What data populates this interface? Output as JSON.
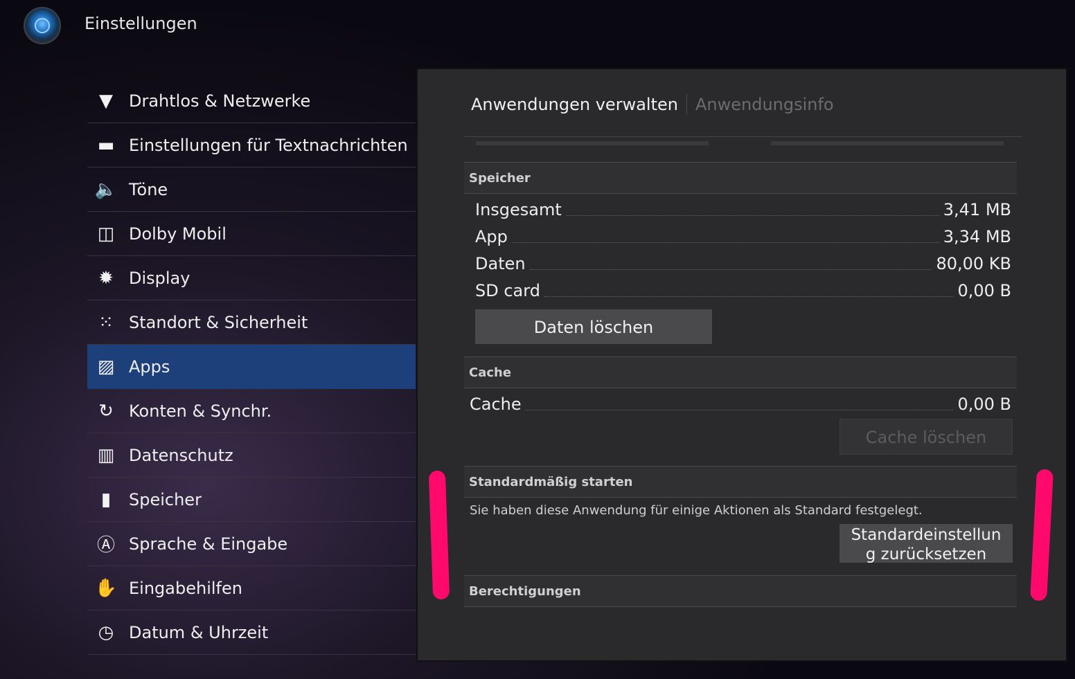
{
  "header": {
    "title": "Einstellungen",
    "icon": "settings-app-icon"
  },
  "menu": {
    "items": [
      {
        "label": "Drahtlos & Netzwerke",
        "icon": "wifi-icon",
        "glyph": "▼"
      },
      {
        "label": "Einstellungen für Textnachrichten",
        "icon": "message-icon",
        "glyph": "▬"
      },
      {
        "label": "Töne",
        "icon": "speaker-icon",
        "glyph": "🔈"
      },
      {
        "label": "Dolby Mobil",
        "icon": "dolby-icon",
        "glyph": "◫"
      },
      {
        "label": "Display",
        "icon": "brightness-icon",
        "glyph": "✹"
      },
      {
        "label": "Standort & Sicherheit",
        "icon": "location-grid-icon",
        "glyph": "⁙"
      },
      {
        "label": "Apps",
        "icon": "apps-icon",
        "glyph": "▨"
      },
      {
        "label": "Konten & Synchr.",
        "icon": "sync-icon",
        "glyph": "↻"
      },
      {
        "label": "Datenschutz",
        "icon": "privacy-icon",
        "glyph": "▥"
      },
      {
        "label": "Speicher",
        "icon": "sd-card-icon",
        "glyph": "▮"
      },
      {
        "label": "Sprache & Eingabe",
        "icon": "keyboard-a-icon",
        "glyph": "Ⓐ"
      },
      {
        "label": "Eingabehilfen",
        "icon": "hand-icon",
        "glyph": "✋"
      },
      {
        "label": "Datum & Uhrzeit",
        "icon": "clock-icon",
        "glyph": "◷"
      }
    ],
    "active_index": 6
  },
  "tabs": {
    "active": "Anwendungen verwalten",
    "inactive": "Anwendungsinfo"
  },
  "storage": {
    "header": "Speicher",
    "rows": [
      {
        "key": "Insgesamt",
        "value": "3,41 MB"
      },
      {
        "key": "App",
        "value": "3,34 MB"
      },
      {
        "key": "Daten",
        "value": "80,00 KB"
      },
      {
        "key": "SD card",
        "value": "0,00 B"
      }
    ],
    "clear_button": "Daten löschen"
  },
  "cache": {
    "header": "Cache",
    "key": "Cache",
    "value": "0,00 B",
    "clear_button": "Cache löschen"
  },
  "defaults": {
    "header": "Standardmäßig starten",
    "description": "Sie haben diese Anwendung für einige Aktionen als Standard festgelegt.",
    "reset_button_line1": "Standardeinstellun",
    "reset_button_line2": "g zurücksetzen"
  },
  "permissions": {
    "header": "Berechtigungen"
  },
  "colors": {
    "accent_selected": "#1d3f7a",
    "annotation_marker": "#ff0a6c",
    "panel_bg": "#2a2a2c"
  }
}
